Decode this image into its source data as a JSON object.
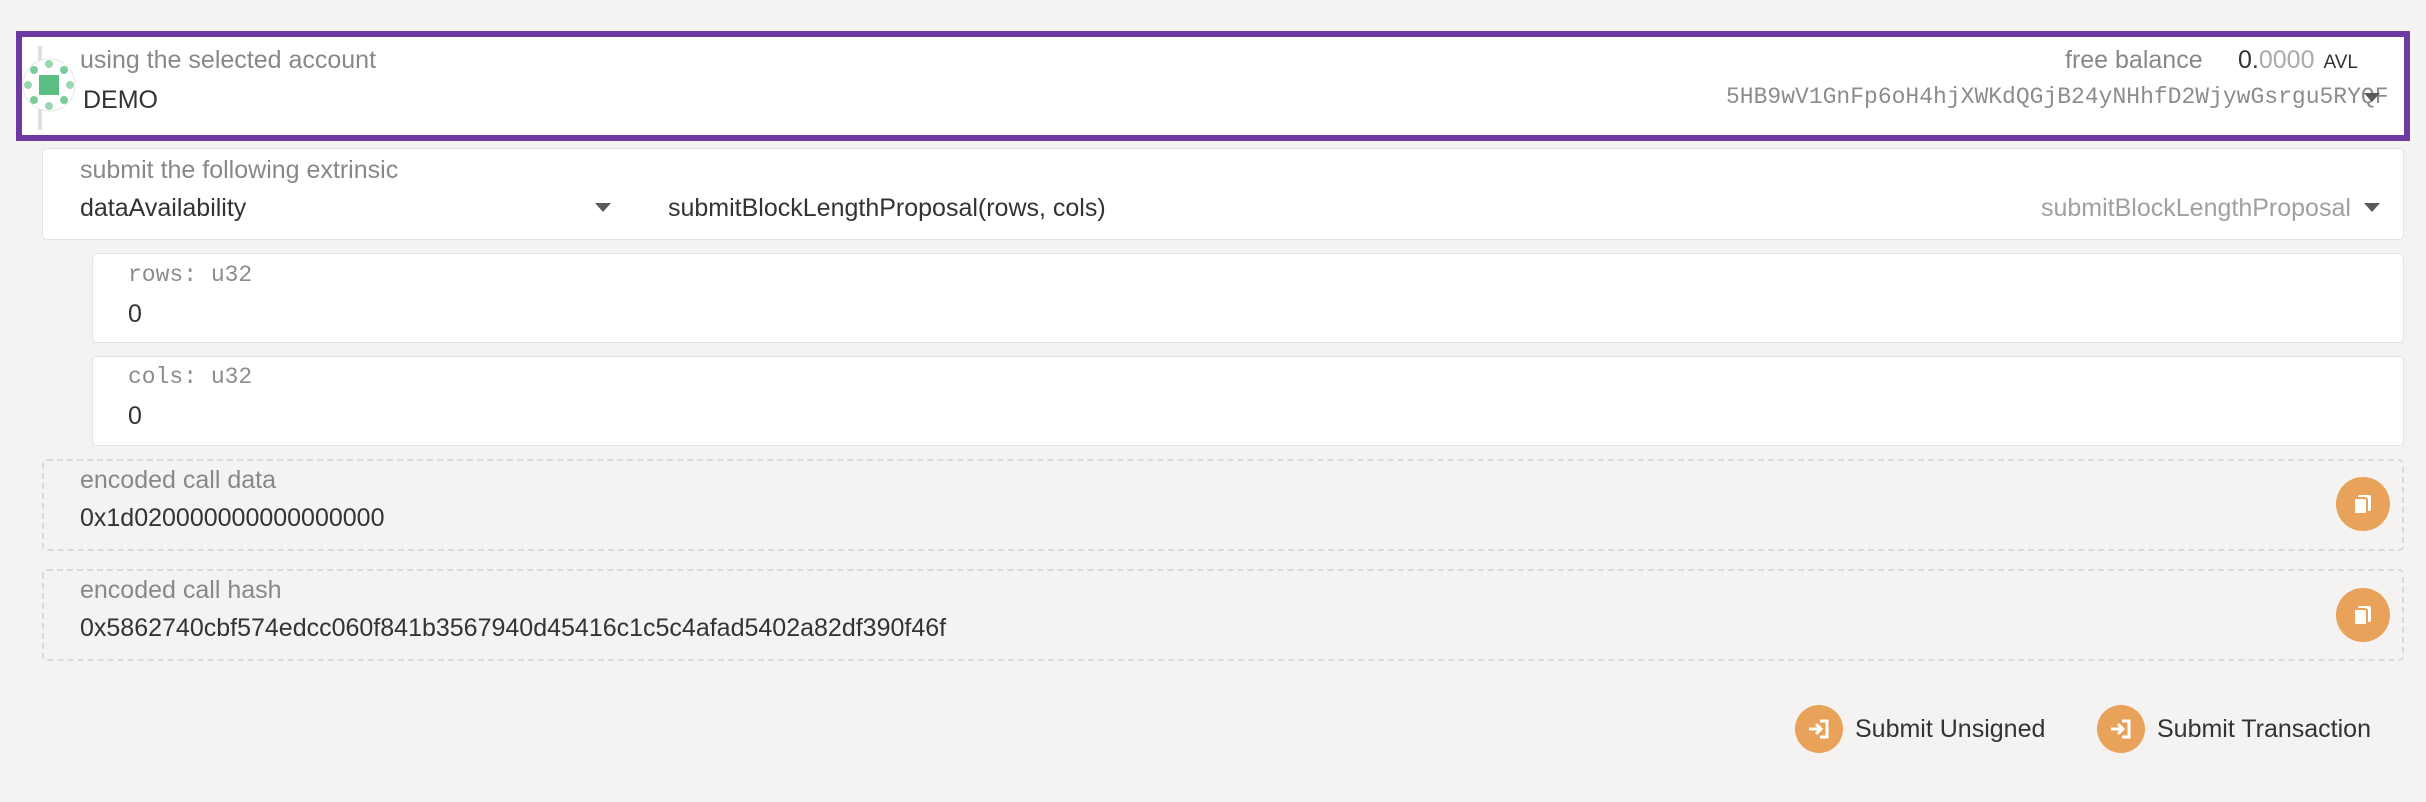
{
  "account": {
    "label": "using the selected account",
    "name": "DEMO",
    "balance_label": "free balance",
    "balance_integer": "0.",
    "balance_decimals": "0000",
    "balance_unit": "AVL",
    "address": "5HB9wV1GnFp6oH4hjXWKdQGjB24yNHhfD2WjywGsrgu5RYQF"
  },
  "extrinsic": {
    "label": "submit the following extrinsic",
    "module": "dataAvailability",
    "call_signature": "submitBlockLengthProposal(rows, cols)",
    "call_name": "submitBlockLengthProposal"
  },
  "params": [
    {
      "label": "rows: u32",
      "value": "0"
    },
    {
      "label": "cols: u32",
      "value": "0"
    }
  ],
  "encoded_call_data": {
    "label": "encoded call data",
    "value": "0x1d020000000000000000"
  },
  "encoded_call_hash": {
    "label": "encoded call hash",
    "value": "0x5862740cbf574edcc060f841b3567940d45416c1c5c4afad5402a82df390f46f"
  },
  "actions": {
    "submit_unsigned": "Submit Unsigned",
    "submit_transaction": "Submit Transaction"
  },
  "colors": {
    "accent": "#e8a259",
    "highlight_border": "#6d3aa1"
  },
  "icons": [
    "avatar-identicon",
    "chevron-down-icon",
    "copy-icon",
    "sign-in-icon"
  ]
}
